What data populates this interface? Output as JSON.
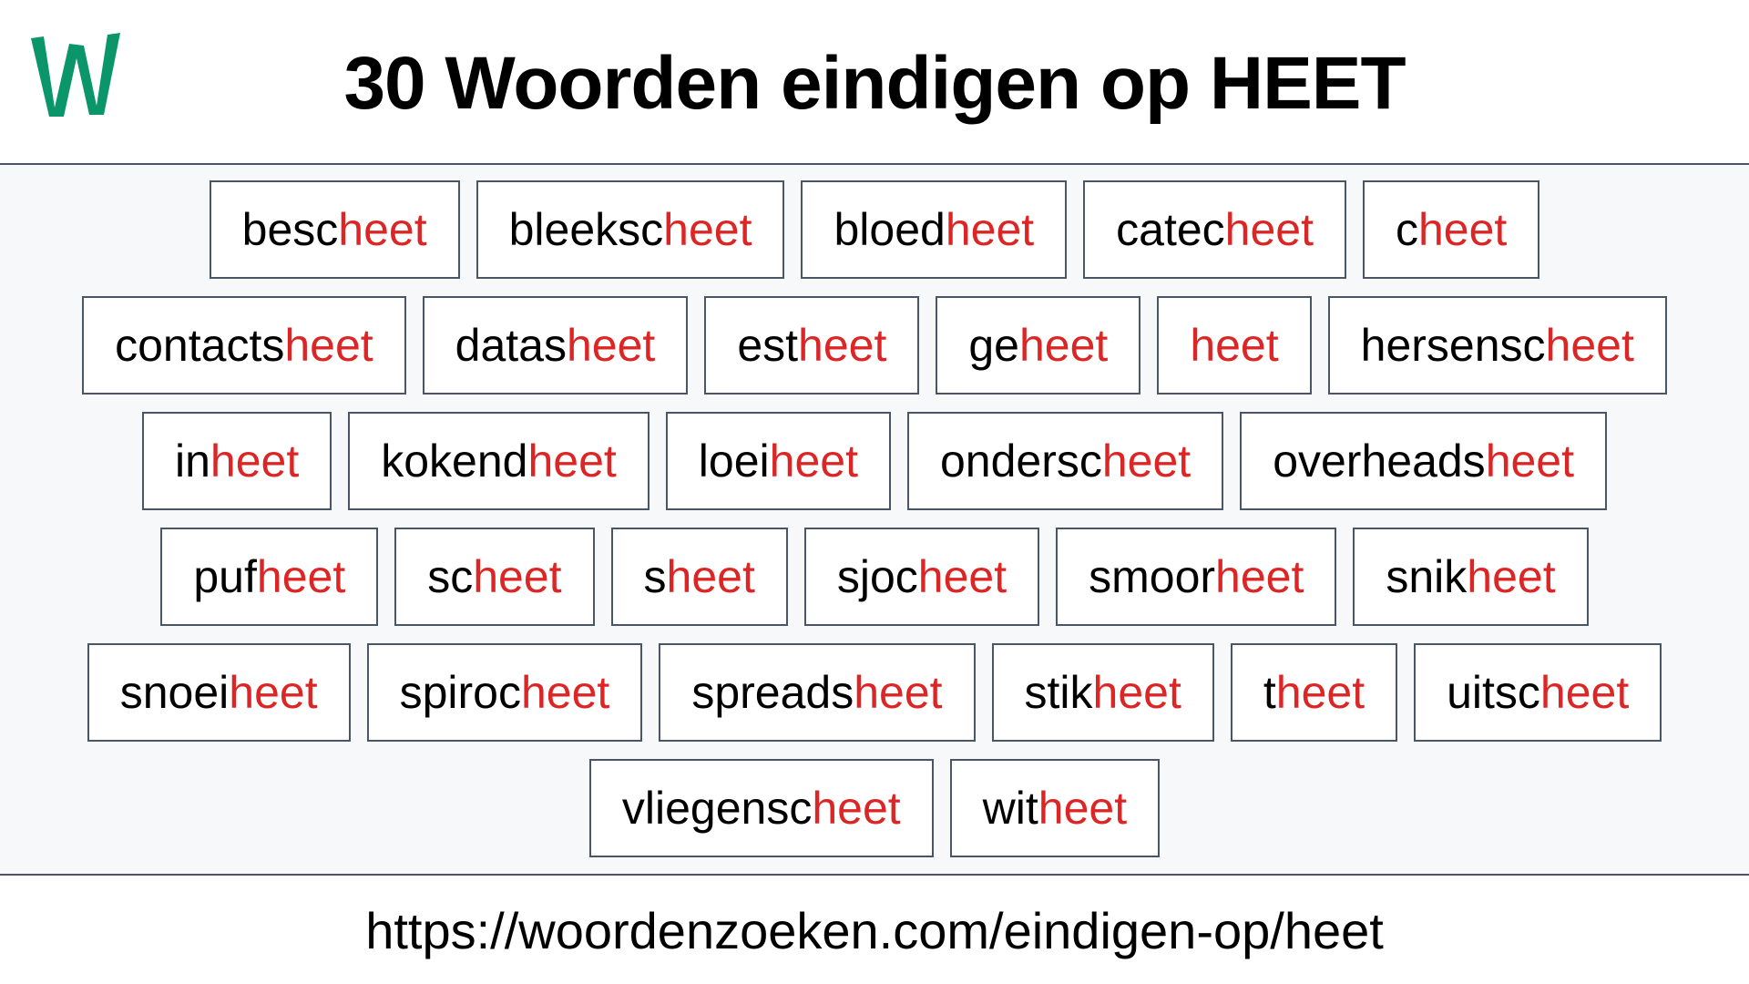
{
  "header": {
    "logo_letter": "W",
    "logo_color": "#0a9669",
    "title": "30 Woorden eindigen op HEET"
  },
  "colors": {
    "suffix": "#dc2626",
    "prefix": "#000000",
    "border": "#4a5566",
    "content_bg": "#f7f8fa"
  },
  "suffix": "heet",
  "rows": [
    [
      {
        "prefix": "besc",
        "suffix": "heet"
      },
      {
        "prefix": "bleeksc",
        "suffix": "heet"
      },
      {
        "prefix": "bloed",
        "suffix": "heet"
      },
      {
        "prefix": "catec",
        "suffix": "heet"
      },
      {
        "prefix": "c",
        "suffix": "heet"
      }
    ],
    [
      {
        "prefix": "contacts",
        "suffix": "heet"
      },
      {
        "prefix": "datas",
        "suffix": "heet"
      },
      {
        "prefix": "est",
        "suffix": "heet"
      },
      {
        "prefix": "ge",
        "suffix": "heet"
      },
      {
        "prefix": "",
        "suffix": "heet"
      },
      {
        "prefix": "hersensc",
        "suffix": "heet"
      }
    ],
    [
      {
        "prefix": "in",
        "suffix": "heet"
      },
      {
        "prefix": "kokend",
        "suffix": "heet"
      },
      {
        "prefix": "loei",
        "suffix": "heet"
      },
      {
        "prefix": "ondersc",
        "suffix": "heet"
      },
      {
        "prefix": "overheads",
        "suffix": "heet"
      }
    ],
    [
      {
        "prefix": "puf",
        "suffix": "heet"
      },
      {
        "prefix": "sc",
        "suffix": "heet"
      },
      {
        "prefix": "s",
        "suffix": "heet"
      },
      {
        "prefix": "sjoc",
        "suffix": "heet"
      },
      {
        "prefix": "smoor",
        "suffix": "heet"
      },
      {
        "prefix": "snik",
        "suffix": "heet"
      }
    ],
    [
      {
        "prefix": "snoei",
        "suffix": "heet"
      },
      {
        "prefix": "spiroc",
        "suffix": "heet"
      },
      {
        "prefix": "spreads",
        "suffix": "heet"
      },
      {
        "prefix": "stik",
        "suffix": "heet"
      },
      {
        "prefix": "t",
        "suffix": "heet"
      },
      {
        "prefix": "uitsc",
        "suffix": "heet"
      }
    ],
    [
      {
        "prefix": "vliegensc",
        "suffix": "heet"
      },
      {
        "prefix": "wit",
        "suffix": "heet"
      }
    ]
  ],
  "footer": {
    "url": "https://woordenzoeken.com/eindigen-op/heet"
  }
}
